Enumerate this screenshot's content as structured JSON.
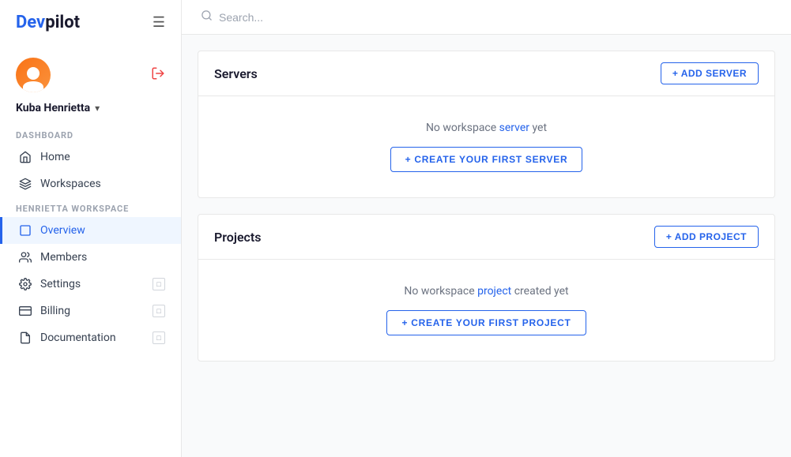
{
  "logo": {
    "part1": "Dev",
    "part2": "pilot"
  },
  "sidebar": {
    "hamburger_label": "☰",
    "user": {
      "name": "Kuba Henrietta",
      "chevron": "▾"
    },
    "dashboard_section_label": "DASHBOARD",
    "dashboard_items": [
      {
        "id": "home",
        "label": "Home",
        "icon": "home"
      },
      {
        "id": "workspaces",
        "label": "Workspaces",
        "icon": "layers"
      }
    ],
    "workspace_section_label": "HENRIETTA WORKSPACE",
    "workspace_items": [
      {
        "id": "overview",
        "label": "Overview",
        "icon": "square",
        "active": true
      },
      {
        "id": "members",
        "label": "Members",
        "icon": "users"
      },
      {
        "id": "settings",
        "label": "Settings",
        "icon": "gear",
        "badge": "□"
      },
      {
        "id": "billing",
        "label": "Billing",
        "icon": "card",
        "badge": "□"
      },
      {
        "id": "documentation",
        "label": "Documentation",
        "icon": "doc",
        "badge": "□"
      }
    ]
  },
  "topbar": {
    "search_placeholder": "Search..."
  },
  "servers_panel": {
    "title": "Servers",
    "add_button": "+ ADD SERVER",
    "empty_text_pre": "No workspace server yet",
    "empty_highlight": "server",
    "create_button": "+ CREATE YOUR FIRST SERVER"
  },
  "projects_panel": {
    "title": "Projects",
    "add_button": "+ ADD PROJECT",
    "empty_text_pre": "No workspace",
    "empty_text_highlight": "project",
    "empty_text_post": "created yet",
    "create_button": "+ CREATE YOUR FIRST PROJECT"
  }
}
